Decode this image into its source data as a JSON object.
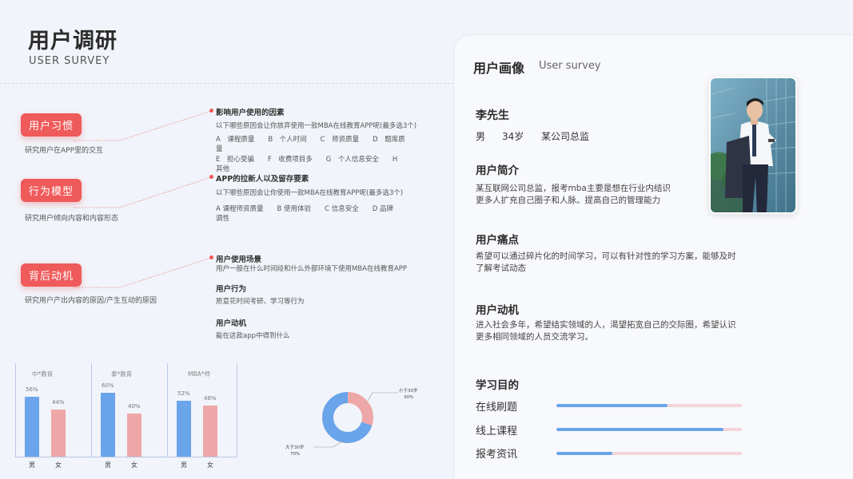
{
  "header": {
    "title": "用户调研",
    "subtitle": "USER SURVEY"
  },
  "categories": [
    {
      "label": "用户习惯",
      "desc": "研究用户在APP里的交互"
    },
    {
      "label": "行为模型",
      "desc": "研究用户倾向内容和内容形态"
    },
    {
      "label": "背后动机",
      "desc": "研究用户产出内容的原因/产生互动的原因"
    }
  ],
  "factors": {
    "title": "影响用户使用的因素",
    "question": "以下哪些原因会让你放弃使用一款MBA在线教育APP呢(最多选3个)",
    "options_line1": "A　课程质量　　B　个人时间　　C　师资质量　　D　题库质",
    "options_line2": "量",
    "options_line3": "E　担心受骗　　F　收费项目多　　G　个人信息安全　　H",
    "options_line4": "其他"
  },
  "retention": {
    "title": "APP的拉新人以及留存要素",
    "question": "以下哪些原因会让你使用一款MBA在线教育APP呢(最多选3个)",
    "options_line1": "A 课程师资质量　　B 使用体验　　C 信息安全　　D 品牌",
    "options_line2": "调性"
  },
  "scenario": {
    "title": "用户使用场景",
    "text": "用户一般在什么时间段和什么外部环境下使用MBA在线教育APP"
  },
  "behavior": {
    "title": "用户行为",
    "text": "愿意花时间考研、学习等行为"
  },
  "motive": {
    "title": "用户动机",
    "text": "能在这款app中得到什么"
  },
  "chart_data": [
    {
      "type": "bar",
      "groups": [
        {
          "name": "中*教育",
          "categories": [
            "男",
            "女"
          ],
          "values": [
            56,
            44
          ],
          "labels": [
            "56%",
            "44%"
          ]
        },
        {
          "name": "泰*教育",
          "categories": [
            "男",
            "女"
          ],
          "values": [
            60,
            40
          ],
          "labels": [
            "60%",
            "40%"
          ]
        },
        {
          "name": "MBA*师",
          "categories": [
            "男",
            "女"
          ],
          "values": [
            52,
            48
          ],
          "labels": [
            "52%",
            "48%"
          ]
        }
      ],
      "colors": [
        "#6aa4ea",
        "#eea7a7"
      ],
      "ylim": [
        0,
        100
      ]
    },
    {
      "type": "pie",
      "donut": true,
      "slices": [
        {
          "name": "小于30岁",
          "value": 30,
          "label": "30%",
          "color": "#eea7a7"
        },
        {
          "name": "大于30岁",
          "value": 70,
          "label": "70%",
          "color": "#6aa4ea"
        }
      ]
    }
  ],
  "persona": {
    "title": "用户画像",
    "subtitle": "User survey",
    "name": "李先生",
    "gender": "男",
    "age": "34岁",
    "job": "某公司总监",
    "intro_head": "用户简介",
    "intro_line1": "某互联网公司总监，报考mba主要是想在行业内结识",
    "intro_line2": "更多人扩充自己圈子和人脉。提高自己的管理能力",
    "pain_head": "用户痛点",
    "pain_line1": "希望可以通过碎片化的时间学习，可以有针对性的学习方案，能够及时",
    "pain_line2": "了解考试动态",
    "motive_head": "用户动机",
    "motive_line1": "进入社会多年，希望结实领域的人，渴望拓宽自己的交际圈，希望认识",
    "motive_line2": "更多相同领域的人员交流学习。",
    "goals_head": "学习目的",
    "goals": [
      {
        "label": "在线刷题",
        "fraction": 0.6
      },
      {
        "label": "线上课程",
        "fraction": 0.9
      },
      {
        "label": "报考资讯",
        "fraction": 0.3
      }
    ]
  },
  "colors": {
    "accent_red": "#ef5a5a",
    "blue": "#6aa4ea",
    "pink": "#eea7a7",
    "background": "#f1f4fa"
  }
}
